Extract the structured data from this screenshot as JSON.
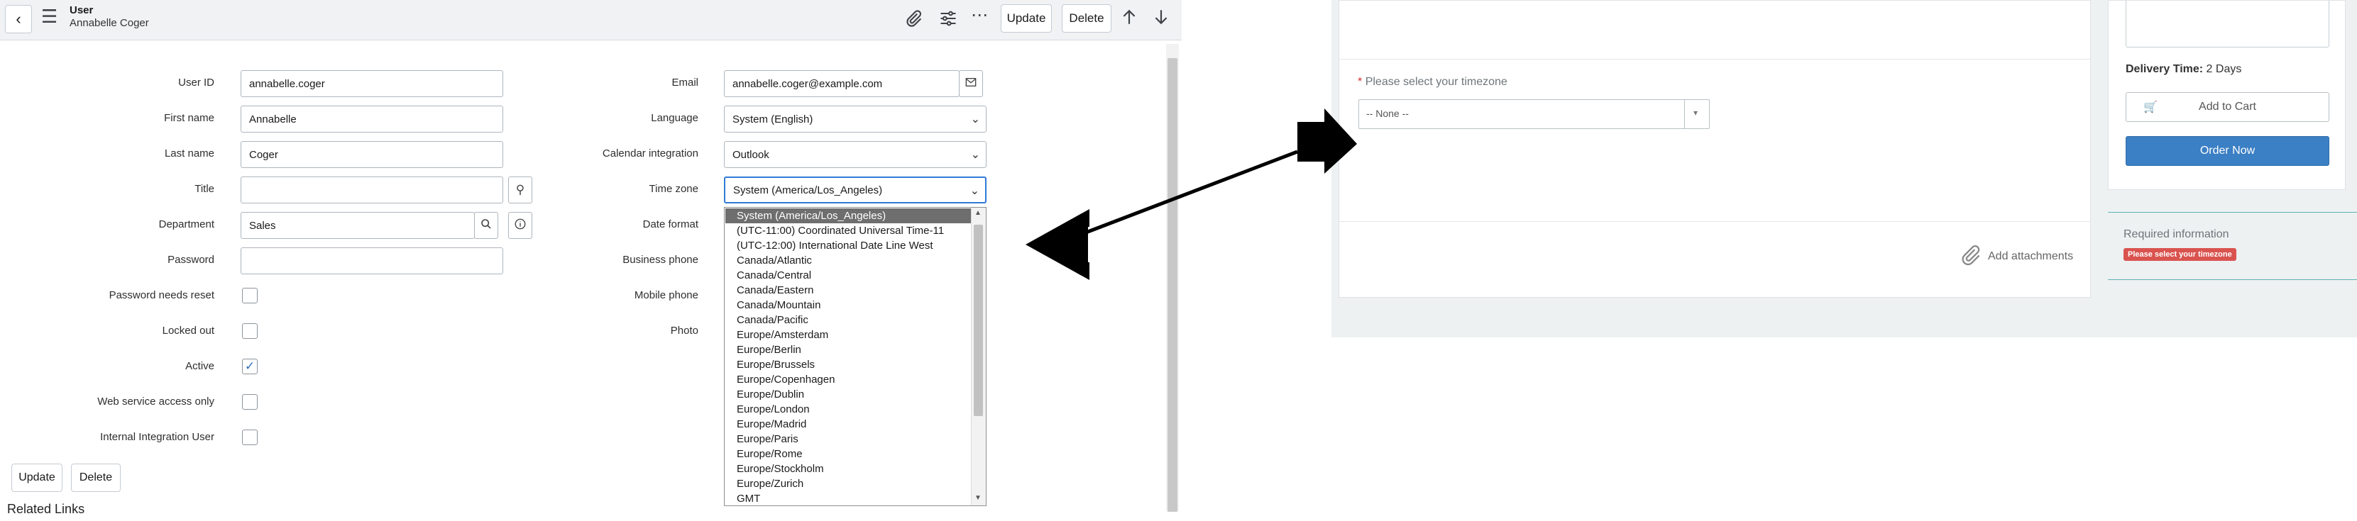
{
  "left": {
    "header": {
      "record_type": "User",
      "record_name": "Annabelle Coger",
      "update_label": "Update",
      "delete_label": "Delete"
    },
    "fields": {
      "user_id": {
        "label": "User ID",
        "value": "annabelle.coger"
      },
      "first_name": {
        "label": "First name",
        "value": "Annabelle"
      },
      "last_name": {
        "label": "Last name",
        "value": "Coger"
      },
      "title": {
        "label": "Title",
        "value": ""
      },
      "department": {
        "label": "Department",
        "value": "Sales"
      },
      "password": {
        "label": "Password",
        "value": ""
      },
      "password_needs_reset": {
        "label": "Password needs reset",
        "checked": false
      },
      "locked_out": {
        "label": "Locked out",
        "checked": false
      },
      "active": {
        "label": "Active",
        "checked": true
      },
      "web_service_access_only": {
        "label": "Web service access only",
        "checked": false
      },
      "internal_integration_user": {
        "label": "Internal Integration User",
        "checked": false
      },
      "email": {
        "label": "Email",
        "value": "annabelle.coger@example.com"
      },
      "language": {
        "label": "Language",
        "value": "System (English)"
      },
      "calendar_integration": {
        "label": "Calendar integration",
        "value": "Outlook"
      },
      "time_zone": {
        "label": "Time zone",
        "value": "System (America/Los_Angeles)"
      },
      "date_format": {
        "label": "Date format"
      },
      "business_phone": {
        "label": "Business phone"
      },
      "mobile_phone": {
        "label": "Mobile phone"
      },
      "photo": {
        "label": "Photo"
      }
    },
    "timezone_options": [
      "System (America/Los_Angeles)",
      "(UTC-11:00) Coordinated Universal Time-11",
      "(UTC-12:00) International Date Line West",
      "Canada/Atlantic",
      "Canada/Central",
      "Canada/Eastern",
      "Canada/Mountain",
      "Canada/Pacific",
      "Europe/Amsterdam",
      "Europe/Berlin",
      "Europe/Brussels",
      "Europe/Copenhagen",
      "Europe/Dublin",
      "Europe/London",
      "Europe/Madrid",
      "Europe/Paris",
      "Europe/Rome",
      "Europe/Stockholm",
      "Europe/Zurich",
      "GMT"
    ],
    "footer": {
      "update_label": "Update",
      "delete_label": "Delete",
      "related_links": "Related Links"
    }
  },
  "right": {
    "timezone_prompt": "Please select your timezone",
    "required_marker": "*",
    "timezone_select_value": "-- None --",
    "delivery_label": "Delivery Time:",
    "delivery_value": "2 Days",
    "add_to_cart_label": "Add to Cart",
    "order_now_label": "Order Now",
    "add_attachments_label": "Add attachments",
    "required_info_label": "Required information",
    "required_badge": "Please select your timezone",
    "colors": {
      "order_now": "#3b7fc4",
      "required_badge": "#d9534f",
      "required_asterisk": "#d32f2f"
    }
  }
}
